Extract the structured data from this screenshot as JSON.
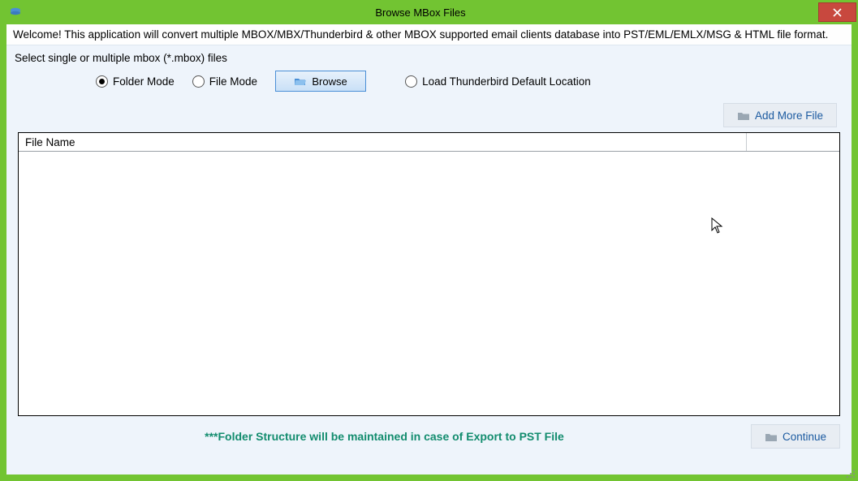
{
  "window": {
    "title": "Browse MBox Files"
  },
  "welcome": "Welcome! This application will convert multiple MBOX/MBX/Thunderbird & other MBOX supported email clients database into PST/EML/EMLX/MSG & HTML file format.",
  "select": {
    "label": "Select single or multiple mbox (*.mbox) files",
    "folder_mode": "Folder Mode",
    "file_mode": "File Mode",
    "browse": "Browse",
    "thunderbird": "Load Thunderbird Default Location",
    "selected_mode": "folder"
  },
  "buttons": {
    "add_more": "Add More File",
    "continue": "Continue"
  },
  "table": {
    "columns": {
      "file_name": "File Name"
    },
    "rows": []
  },
  "footer_note": "***Folder Structure will be maintained in case of Export to PST File"
}
